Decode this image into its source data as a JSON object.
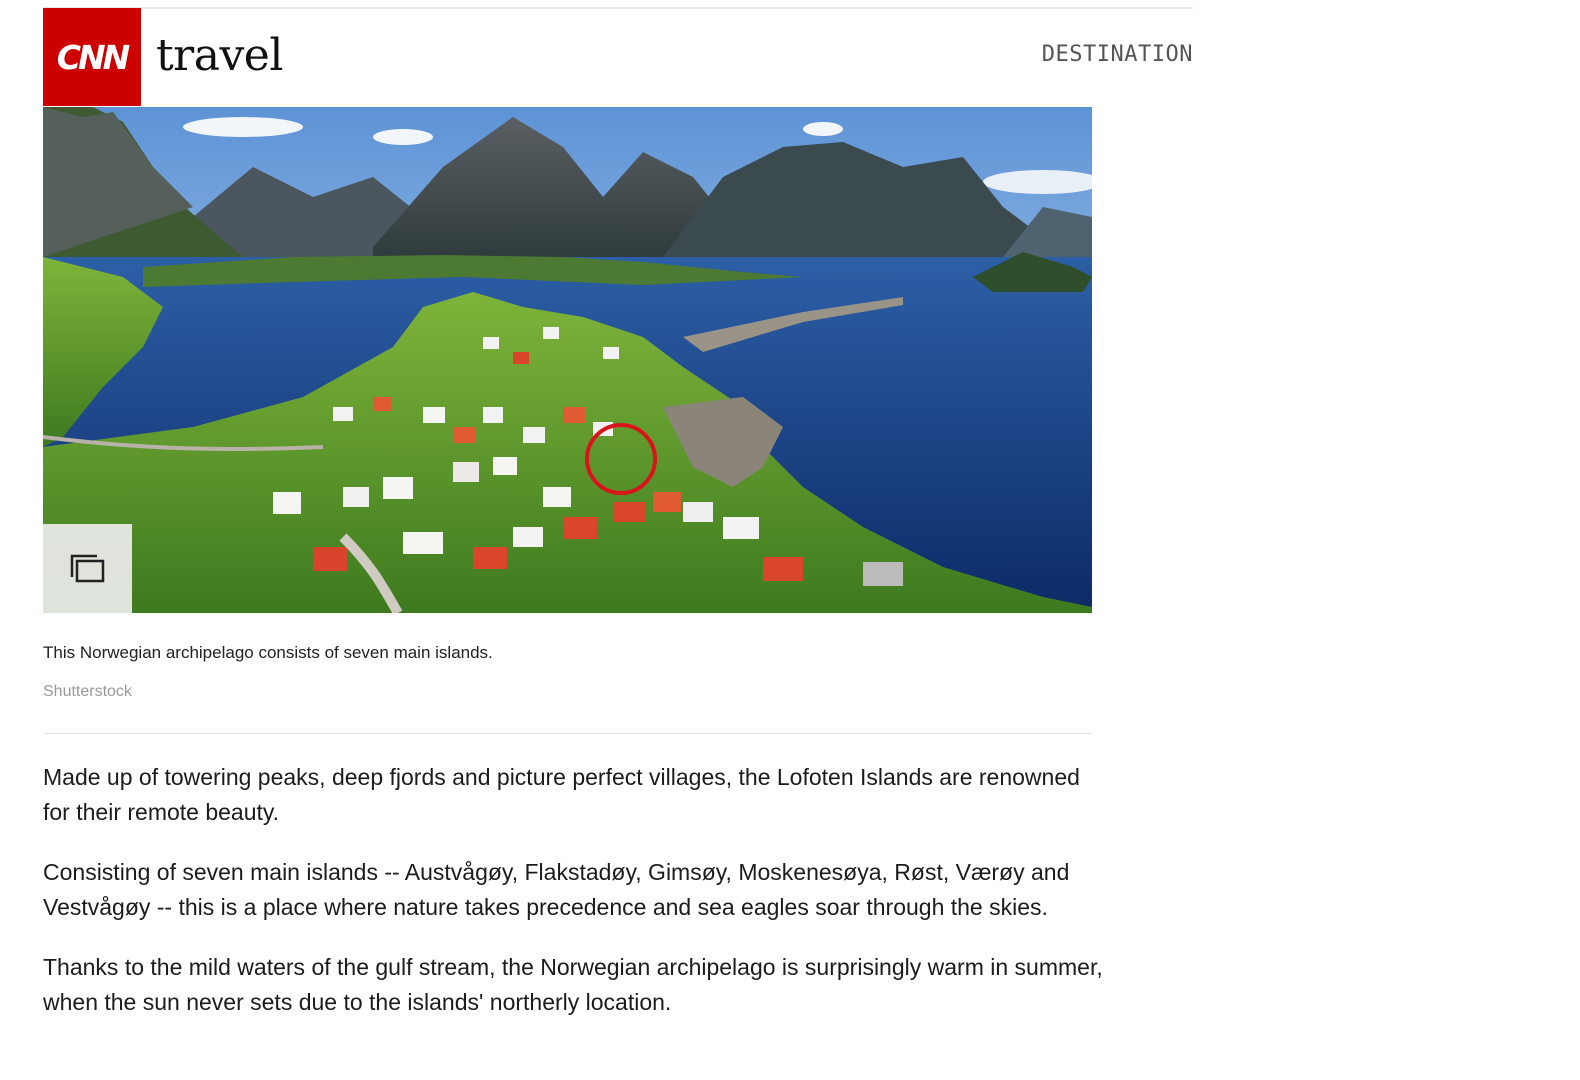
{
  "header": {
    "logo_text": "CNN",
    "section": "travel",
    "nav_label": "DESTINATION"
  },
  "hero": {
    "alt": "Aerial view of a fjord village surrounded by mountains",
    "caption": "This Norwegian archipelago consists of seven main islands.",
    "credit": "Shutterstock",
    "gallery_icon": "gallery-icon"
  },
  "article": {
    "paragraphs": [
      "Made up of towering peaks, deep fjords and picture perfect villages, the Lofoten Islands are renowned for their remote beauty.",
      "Consisting of seven main islands -- Austvågøy, Flakstadøy, Gimsøy, Moskenesøya, Røst, Værøy and Vestvågøy -- this is a place where nature takes precedence and sea eagles soar through the skies.",
      "Thanks to the mild waters of the gulf stream, the Norwegian archipelago is surprisingly warm in summer, when the sun never sets due to the islands' northerly location."
    ]
  },
  "colors": {
    "brand_red": "#cc0000",
    "annotation_circle": "#d9151b"
  }
}
